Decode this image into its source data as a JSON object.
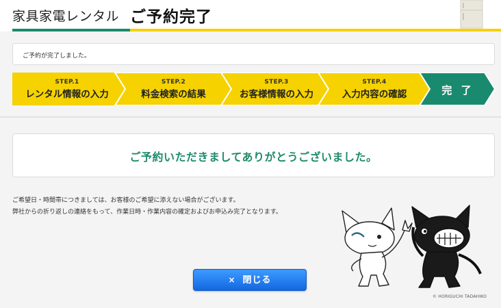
{
  "header": {
    "brand": "家具家電レンタル",
    "title": "ご予約完了"
  },
  "message": "ご予約が完了しました。",
  "steps": [
    {
      "num": "STEP.1",
      "label": "レンタル情報の入力"
    },
    {
      "num": "STEP.2",
      "label": "料金検索の結果"
    },
    {
      "num": "STEP.3",
      "label": "お客様情報の入力"
    },
    {
      "num": "STEP.4",
      "label": "入力内容の確認"
    },
    {
      "num": "",
      "label": "完 了"
    }
  ],
  "thanks": "ご予約いただきましてありがとうございました。",
  "notes": [
    "ご希望日・時間帯につきましては、お客様のご希望に添えない場合がございます。",
    "弊社からの折り返しの連絡をもって、作業日時・作業内容の確定およびお申込み完了となります。"
  ],
  "close_button": {
    "icon": "×",
    "label": "閉じる"
  },
  "copyright": "© HORIGUCHI TADAHIKO",
  "colors": {
    "step_yellow": "#f5d200",
    "step_green": "#1a8a6e",
    "thanks_text": "#1f8a6b",
    "button_blue": "#1e7cf0"
  }
}
